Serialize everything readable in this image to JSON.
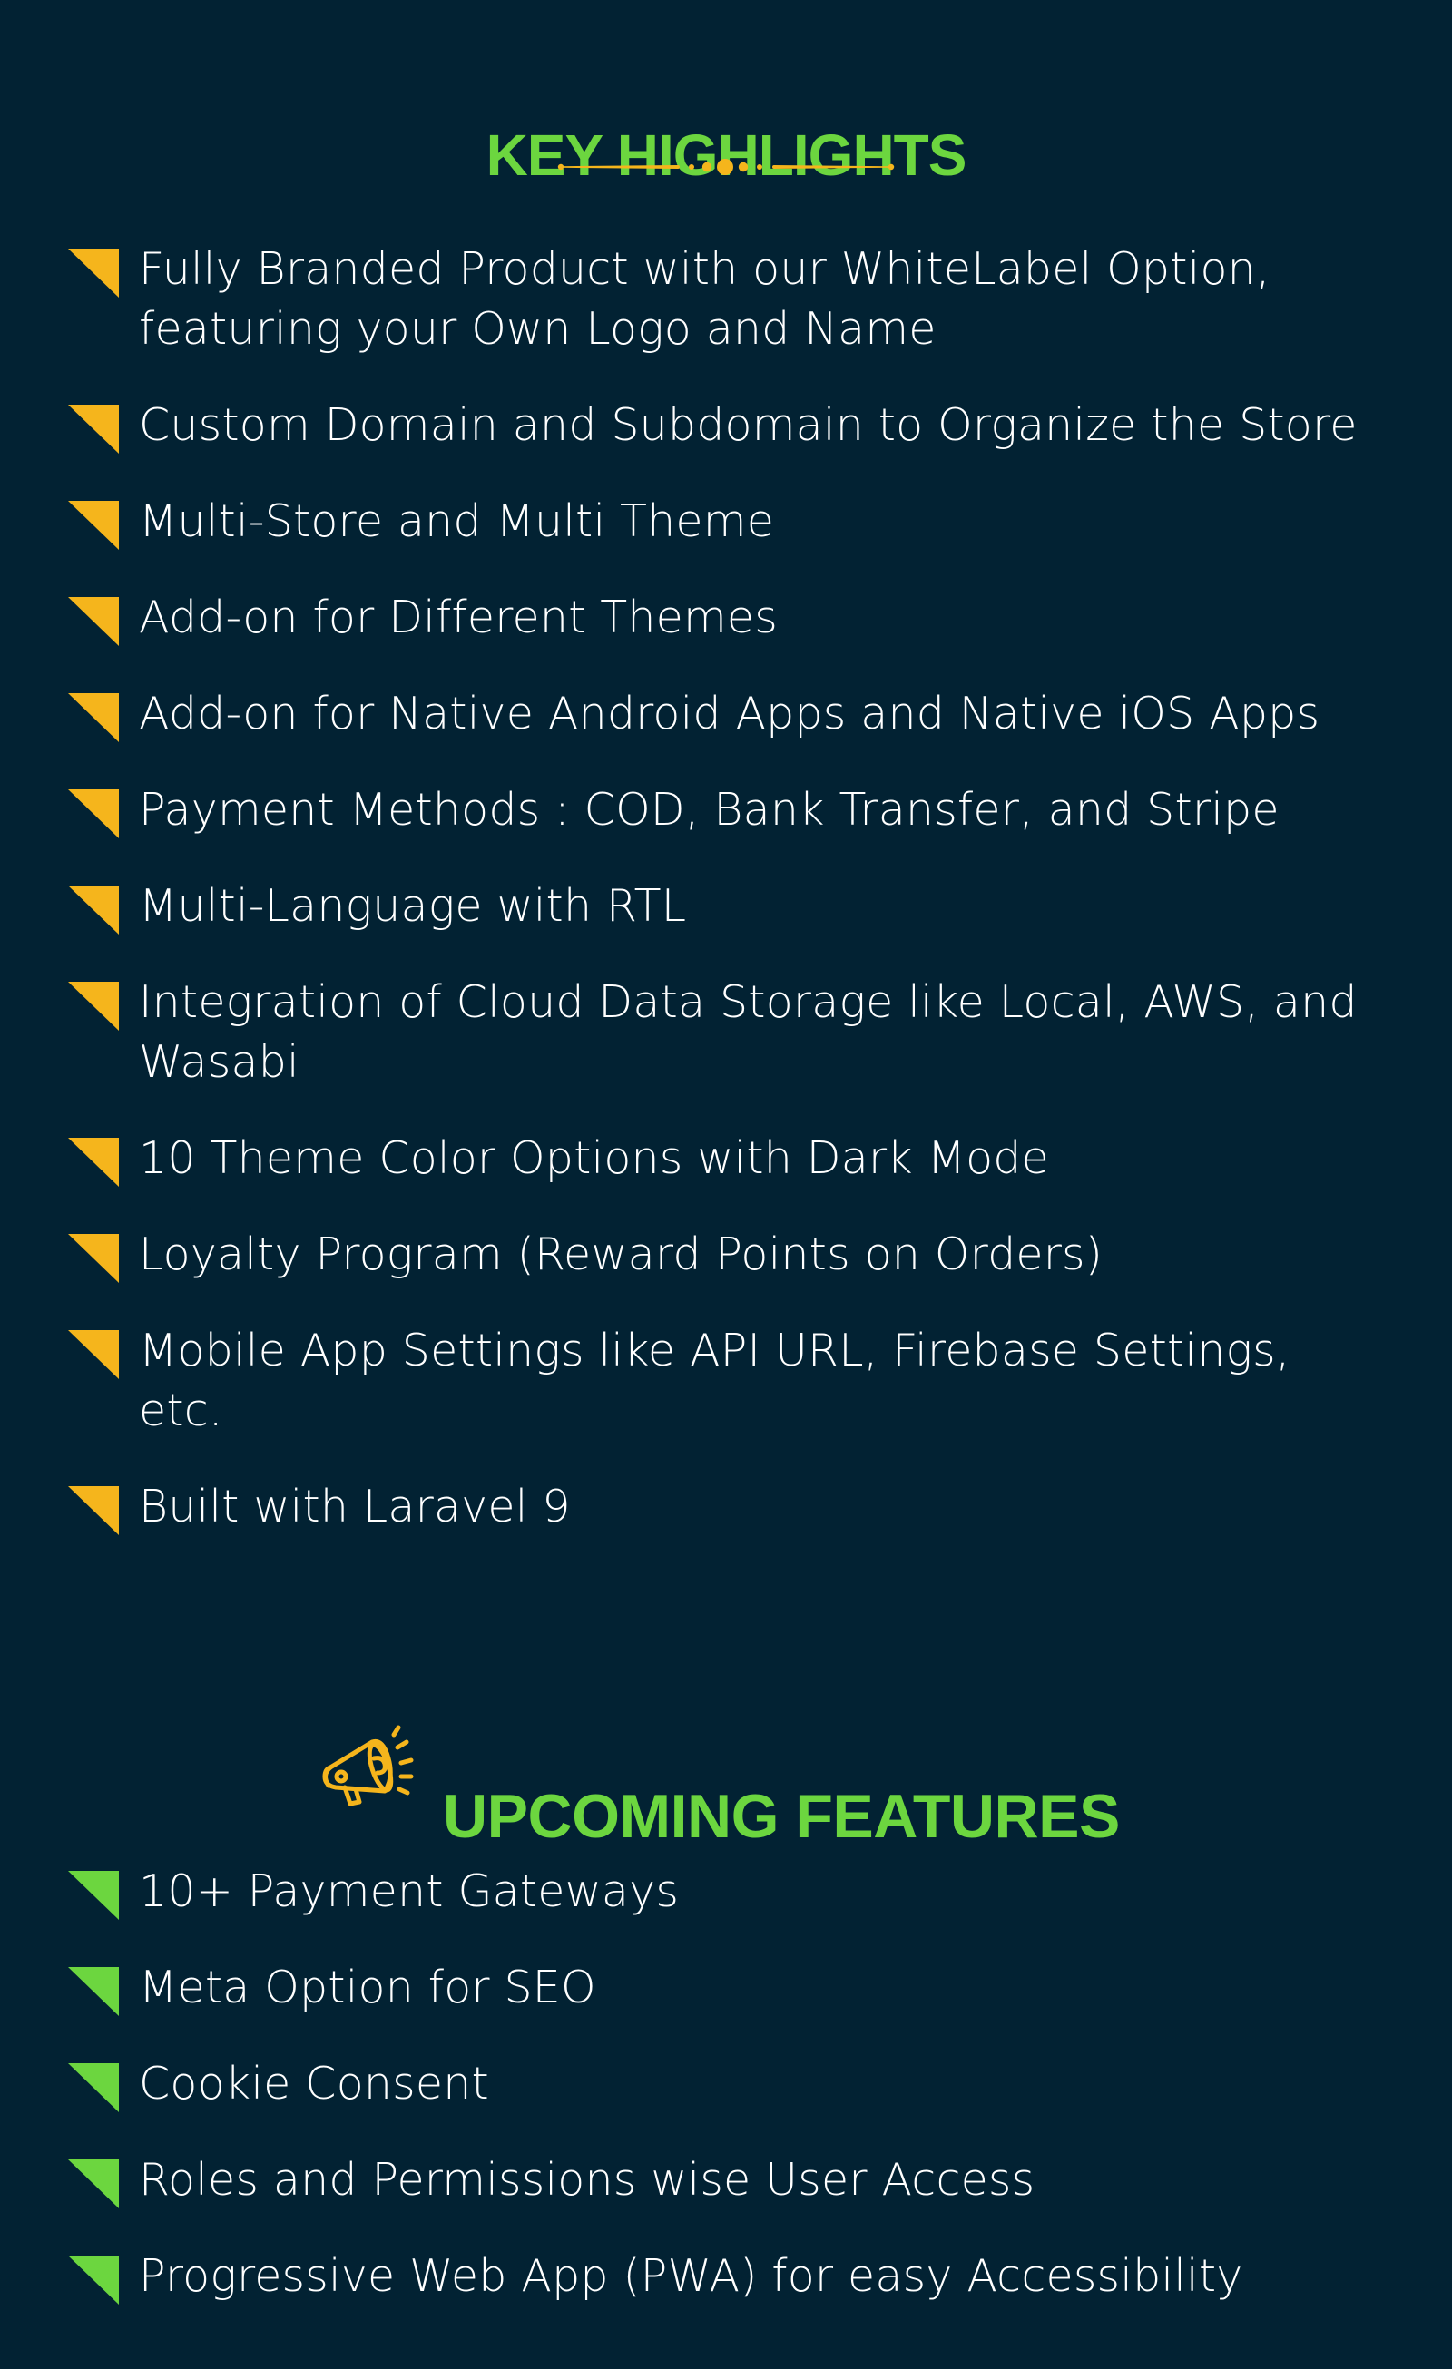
{
  "colors": {
    "background": "#022233",
    "heading": "#6CD63F",
    "accent_yellow": "#F5B51C",
    "accent_green": "#6CD63F",
    "text": "#FFFFFF"
  },
  "key_highlights": {
    "title": "KEY HIGHLIGHTS",
    "divider_icon": "ornamental-divider",
    "bullet_icon": "yellow-triangle-bullet",
    "items": [
      "Fully Branded Product with our WhiteLabel Option, featuring your Own Logo and Name",
      "Custom Domain and Subdomain to Organize the Store",
      "Multi-Store and Multi Theme",
      "Add-on for Different Themes",
      "Add-on for Native Android Apps and Native iOS Apps",
      "Payment Methods : COD, Bank Transfer, and Stripe",
      "Multi-Language with RTL",
      "Integration of Cloud Data Storage like Local, AWS, and Wasabi",
      "10 Theme Color Options with Dark Mode",
      "Loyalty Program (Reward Points on Orders)",
      "Mobile App Settings like API URL, Firebase Settings, etc.",
      "Built with Laravel 9"
    ]
  },
  "upcoming_features": {
    "title": "UPCOMING FEATURES",
    "icon": "megaphone-icon",
    "bullet_icon": "green-triangle-bullet",
    "items": [
      "10+ Payment Gateways",
      "Meta Option for SEO",
      "Cookie Consent",
      "Roles and Permissions wise User Access",
      "Progressive Web App (PWA) for easy Accessibility"
    ]
  }
}
